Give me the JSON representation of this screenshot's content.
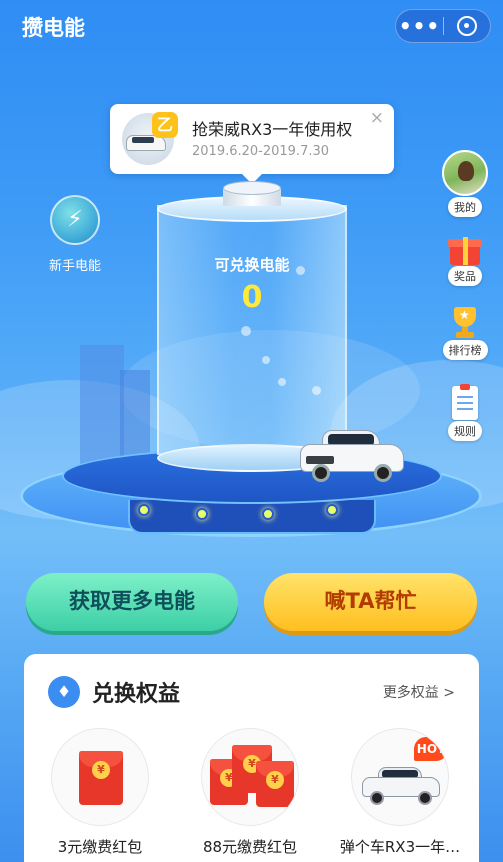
{
  "header": {
    "title": "攒电能",
    "more_label": "•••",
    "close_icon": "target-close-icon"
  },
  "promo": {
    "title": "抢荣威RX3一年使用权",
    "date_range": "2019.6.20-2019.7.30",
    "badge": "乙",
    "close_label": "×"
  },
  "side_menu": {
    "profile_label": "我的",
    "prize_label": "奖品",
    "ranking_label": "排行榜",
    "rules_label": "规则"
  },
  "newbie": {
    "label": "新手电能"
  },
  "battery": {
    "label": "可兑换电能",
    "value": "0"
  },
  "actions": {
    "get_more_label": "获取更多电能",
    "ask_help_label": "喊TA帮忙"
  },
  "benefits": {
    "title": "兑换权益",
    "more_label": "更多权益 >",
    "items": [
      {
        "label": "3元缴费红包"
      },
      {
        "label": "88元缴费红包"
      },
      {
        "label": "弹个车RX3一年…",
        "tag": "HOT"
      }
    ]
  },
  "colors": {
    "sky_blue": "#2f8df4",
    "energy_yellow": "#ffe93a",
    "cta_green": "#3ccfa6",
    "cta_yellow": "#ffbf1f",
    "red_envelope": "#e7372a"
  }
}
